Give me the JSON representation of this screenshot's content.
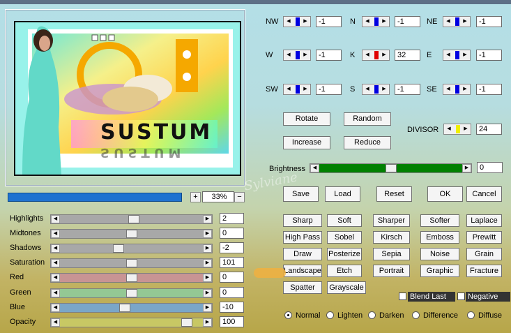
{
  "preview": {
    "title_text": "SUSTUM",
    "zoom_value": "33%",
    "zoom_plus": "+",
    "zoom_minus": "−",
    "progress_fraction": 1.0
  },
  "sliders": [
    {
      "label": "Highlights",
      "value": "2",
      "level": 0.52,
      "color": "#a8a8a8"
    },
    {
      "label": "Midtones",
      "value": "0",
      "level": 0.5,
      "color": "#a8a8a8"
    },
    {
      "label": "Shadows",
      "value": "-2",
      "level": 0.4,
      "color": "#a8a8a8"
    },
    {
      "label": "Saturation",
      "value": "101",
      "level": 0.5,
      "color": "#a8a8a8"
    },
    {
      "label": "Red",
      "value": "0",
      "level": 0.5,
      "color": "#c89494"
    },
    {
      "label": "Green",
      "value": "0",
      "level": 0.5,
      "color": "#94c894"
    },
    {
      "label": "Blue",
      "value": "-10",
      "level": 0.45,
      "color": "#7aa6c8"
    },
    {
      "label": "Opacity",
      "value": "100",
      "level": 0.92,
      "color": "#c8c864"
    }
  ],
  "matrix": [
    {
      "label": "NW",
      "value": "-1",
      "color": "#0000e0"
    },
    {
      "label": "N",
      "value": "-1",
      "color": "#0000e0"
    },
    {
      "label": "NE",
      "value": "-1",
      "color": "#0000e0"
    },
    {
      "label": "W",
      "value": "-1",
      "color": "#0000e0"
    },
    {
      "label": "K",
      "value": "32",
      "color": "#e00000"
    },
    {
      "label": "E",
      "value": "-1",
      "color": "#0000e0"
    },
    {
      "label": "SW",
      "value": "-1",
      "color": "#0000e0"
    },
    {
      "label": "S",
      "value": "-1",
      "color": "#0000e0"
    },
    {
      "label": "SE",
      "value": "-1",
      "color": "#0000e0"
    }
  ],
  "controls": {
    "rotate": "Rotate",
    "random": "Random",
    "increase": "Increase",
    "reduce": "Reduce",
    "divisor_label": "DIVISOR",
    "divisor_value": "24",
    "divisor_color": "#f0f000",
    "brightness_label": "Brightness",
    "brightness_value": "0",
    "brightness_level": 0.5,
    "save": "Save",
    "load": "Load",
    "reset": "Reset",
    "ok": "OK",
    "cancel": "Cancel"
  },
  "presets": [
    "Sharp",
    "Soft",
    "Sharper",
    "Softer",
    "Laplace",
    "High Pass",
    "Sobel",
    "Kirsch",
    "Emboss",
    "Prewitt",
    "Draw",
    "Posterize",
    "Sepia",
    "Noise",
    "Grain",
    "Landscape",
    "Etch",
    "Portrait",
    "Graphic",
    "Fracture",
    "Spatter",
    "Grayscale"
  ],
  "checks": {
    "blend_last": "Blend Last",
    "negative": "Negative"
  },
  "modes": [
    {
      "label": "Normal",
      "selected": true
    },
    {
      "label": "Lighten",
      "selected": false
    },
    {
      "label": "Darken",
      "selected": false
    },
    {
      "label": "Difference",
      "selected": false
    },
    {
      "label": "Diffuse",
      "selected": false
    }
  ],
  "watermark": "Sylviane"
}
